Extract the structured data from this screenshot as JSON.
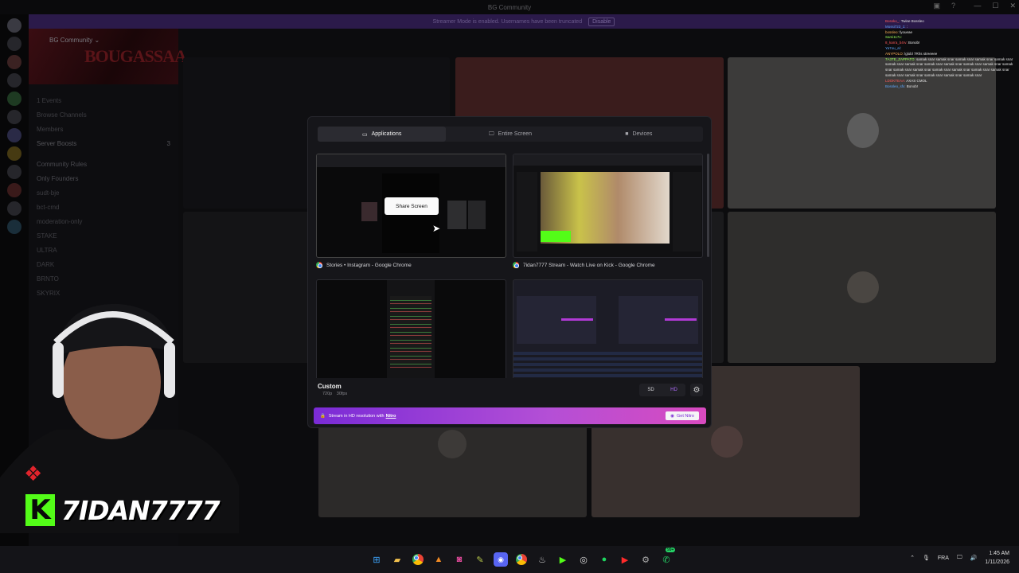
{
  "window": {
    "title": "BG Community"
  },
  "streamer_banner": {
    "text": "Streamer Mode is enabled. Usernames have been truncated",
    "disable_label": "Disable"
  },
  "sidebar": {
    "guild_name": "BG Community ⌄",
    "banner_wordmark": "BOUGASSAA",
    "items": [
      {
        "label": "1 Events"
      },
      {
        "label": "Browse Channels"
      },
      {
        "label": "Members"
      },
      {
        "label": "Server Boosts",
        "badge": "3"
      }
    ],
    "categories": [
      {
        "label": "Community Rules"
      },
      {
        "label": "Only Founders"
      },
      {
        "label": "sudt-bje"
      },
      {
        "label": "bct-cmd"
      },
      {
        "label": "moderation-only"
      },
      {
        "label": "STAKE"
      },
      {
        "label": "ULTRA"
      },
      {
        "label": "DARK"
      },
      {
        "label": "BRNTO"
      },
      {
        "label": "SKYRIX"
      }
    ]
  },
  "chat_overlay": {
    "lines": [
      {
        "user": "Bossko_",
        "text": "Twine Bossleo"
      },
      {
        "user": "Mossi723_1",
        "text": ":"
      },
      {
        "user": "bossleo",
        "text": "fyoueae"
      },
      {
        "user": "Sami117x",
        "text": ""
      },
      {
        "user": "8_karra_b4rv",
        "text": "Bonob!"
      },
      {
        "user": "Ya7ou_al",
        "text": ""
      },
      {
        "user": "ANYPOLO",
        "text": "lglobl 7Rhs streeeee"
      },
      {
        "user": "7A3TE_ZAPPATO",
        "text": "samak snar samak snar samak snar samak snar samak snar samak snar samak snar samak snar samak snar samak snar samak snar samak snar samak snar samak snar samak snar samak snar samak snar samak snar samak snar samak snar samak snar samak snar samak snar"
      },
      {
        "user": "LDOKTEAA",
        "text": "AXAS CMOL"
      },
      {
        "user": "Bossleo_sfx",
        "text": "Bonob!"
      }
    ]
  },
  "modal": {
    "tabs": [
      {
        "label": "Applications",
        "icon": "window-icon",
        "active": true
      },
      {
        "label": "Entire Screen",
        "icon": "monitor-icon",
        "active": false
      },
      {
        "label": "Devices",
        "icon": "camera-icon",
        "active": false
      }
    ],
    "sources": [
      {
        "caption": "Stories • Instagram - Google Chrome",
        "hover_button": "Share Screen"
      },
      {
        "caption": "7idan7777 Stream - Watch Live on Kick - Google Chrome"
      },
      {
        "caption": ""
      },
      {
        "caption": ""
      }
    ],
    "quality": {
      "title": "Custom",
      "resolution": "720p",
      "fps": "30fps",
      "sd_label": "SD",
      "hd_label": "HD"
    },
    "nitro_banner": {
      "text": "Stream in HD resolution with",
      "link": "Nitro",
      "button": "Get Nitro"
    }
  },
  "webcam": {
    "kick_letter": "K",
    "handle": "7IDAN7777"
  },
  "taskbar": {
    "lang": "FRA",
    "time": "1:45 AM",
    "date": "1/11/2026",
    "badge": "99+"
  },
  "colors": {
    "accent": "#53fc18",
    "nitro_start": "#7a2bd6",
    "nitro_end": "#d84ac0",
    "banner": "#2b1a4a"
  }
}
